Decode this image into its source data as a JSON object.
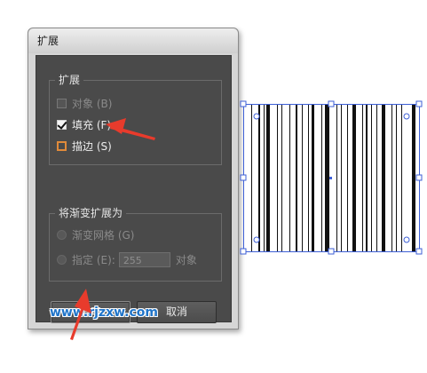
{
  "dialog": {
    "title": "扩展",
    "expand_group": {
      "title": "扩展",
      "options": [
        {
          "label": "对象 (B)",
          "checked": false,
          "enabled": false
        },
        {
          "label": "填充 (F)",
          "checked": true,
          "enabled": true
        },
        {
          "label": "描边 (S)",
          "checked": false,
          "enabled": true
        }
      ]
    },
    "gradient_group": {
      "title": "将渐变扩展为",
      "mesh_label": "渐变网格 (G)",
      "specify_label": "指定 (E):",
      "specify_value": "255",
      "object_label": "对象"
    },
    "ok_label": "确定",
    "cancel_label": "取消"
  },
  "watermark": "www.rjzxw.com",
  "colors": {
    "arrow": "#e83b2c",
    "selection": "#3d5fd6",
    "panel": "#4a4a4a"
  }
}
